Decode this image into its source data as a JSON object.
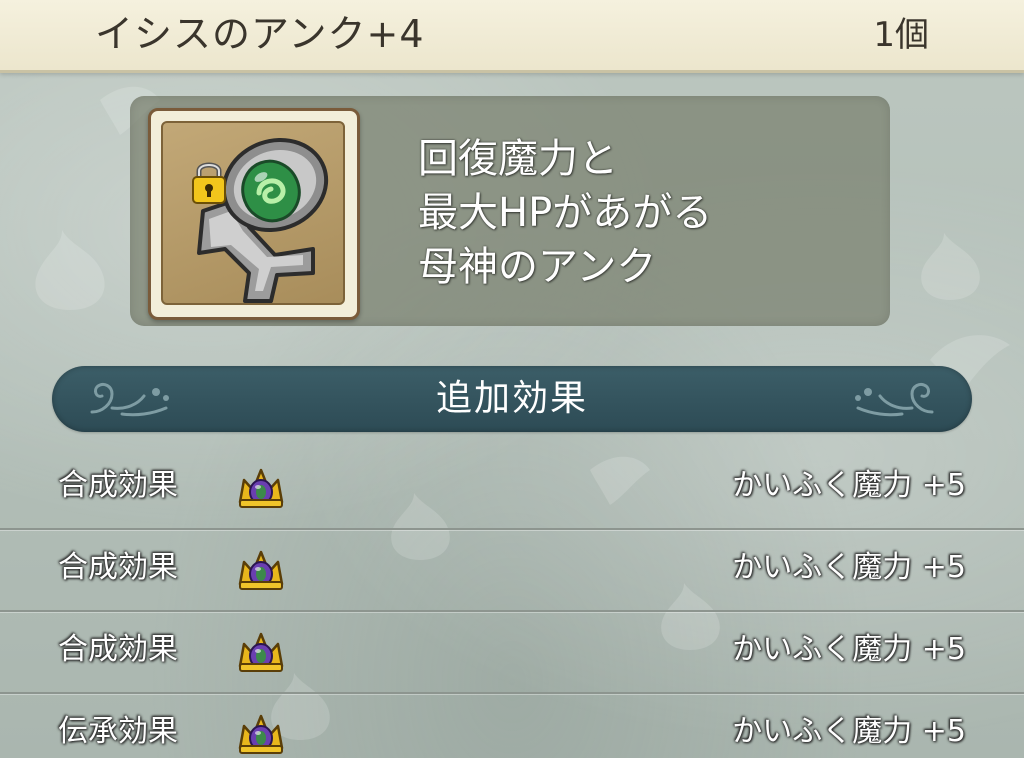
{
  "header": {
    "item_name": "イシスのアンク+4",
    "item_count": "1個"
  },
  "item": {
    "icon": "ankh-icon",
    "locked": true,
    "lock_icon": "lock-icon",
    "description_lines": [
      "回復魔力と",
      "最大HPがあがる",
      "母神のアンク"
    ]
  },
  "section": {
    "title": "追加効果"
  },
  "effects": [
    {
      "label": "合成効果",
      "icon": "crown-icon",
      "value": "かいふく魔力 +5"
    },
    {
      "label": "合成効果",
      "icon": "crown-icon",
      "value": "かいふく魔力 +5"
    },
    {
      "label": "合成効果",
      "icon": "crown-icon",
      "value": "かいふく魔力 +5"
    },
    {
      "label": "伝承効果",
      "icon": "crown-icon",
      "value": "かいふく魔力 +5"
    }
  ],
  "colors": {
    "header_bg": "#f0ead2",
    "banner_bg": "#35555f",
    "panel_bg": "#7a8270",
    "icon_bg": "#b89d6a",
    "gem": "#2f9a4a"
  }
}
